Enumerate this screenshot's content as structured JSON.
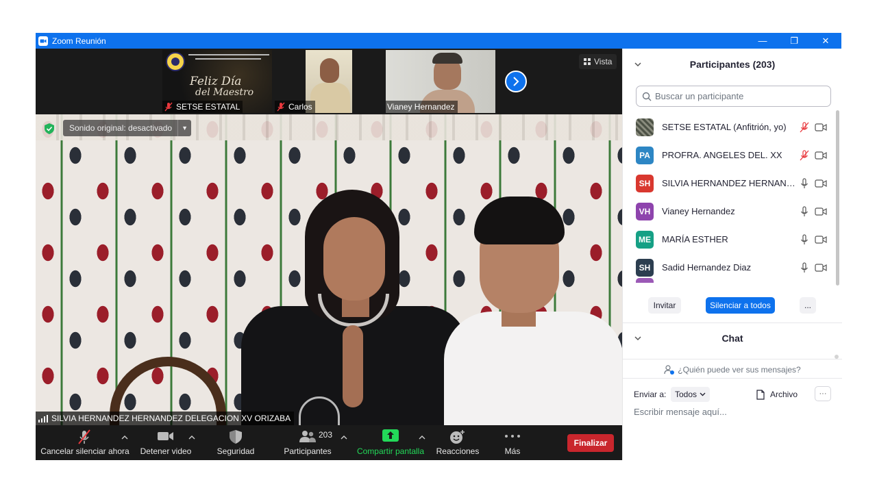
{
  "window": {
    "title": "Zoom Reunión",
    "minimize": "—",
    "restore": "❐",
    "close": "✕"
  },
  "thumbnails": [
    {
      "name": "SETSE ESTATAL",
      "muted": true,
      "banner_line1": "Feliz Día",
      "banner_line2": "del Maestro"
    },
    {
      "name": "Carlos",
      "muted": true
    },
    {
      "name": "Vianey Hernandez",
      "muted": false
    }
  ],
  "view_button": "Vista",
  "main_video": {
    "sound_pill": "Sonido original: desactivado",
    "speaker_name": "SILVIA HERNANDEZ HERNANDEZ DELEGACION XV ORIZABA"
  },
  "toolbar": {
    "mute": "Cancelar silenciar ahora",
    "video": "Detener video",
    "security": "Seguridad",
    "participants": "Participantes",
    "participants_count": "203",
    "share": "Compartir pantalla",
    "reactions": "Reacciones",
    "more": "Más",
    "end": "Finalizar"
  },
  "participants_panel": {
    "title": "Participantes (203)",
    "search_placeholder": "Buscar un participante",
    "list": [
      {
        "initials": "",
        "name": "SETSE ESTATAL (Anfitrión, yo)",
        "color": "#5a5f52",
        "muted": true
      },
      {
        "initials": "PA",
        "name": "PROFRA. ANGELES DEL. XX",
        "color": "#2d86c4",
        "muted": true
      },
      {
        "initials": "SH",
        "name": "SILVIA HERNANDEZ HERNANDEZ DELEGACION XV ORIZABA",
        "color": "#d9382f",
        "muted": false
      },
      {
        "initials": "VH",
        "name": "Vianey Hernandez",
        "color": "#8e44ad",
        "muted": false
      },
      {
        "initials": "ME",
        "name": "MARÍA ESTHER",
        "color": "#16a085",
        "muted": false
      },
      {
        "initials": "SH",
        "name": "Sadid Hernandez Diaz",
        "color": "#2c3e50",
        "muted": false
      }
    ],
    "invite": "Invitar",
    "mute_all": "Silenciar a todos",
    "more": "..."
  },
  "chat_panel": {
    "title": "Chat",
    "who_sees": "¿Quién puede ver sus mensajes?",
    "send_to_label": "Enviar a:",
    "send_to_value": "Todos",
    "file": "Archivo",
    "more": "···",
    "input_placeholder": "Escribir mensaje aquí..."
  }
}
